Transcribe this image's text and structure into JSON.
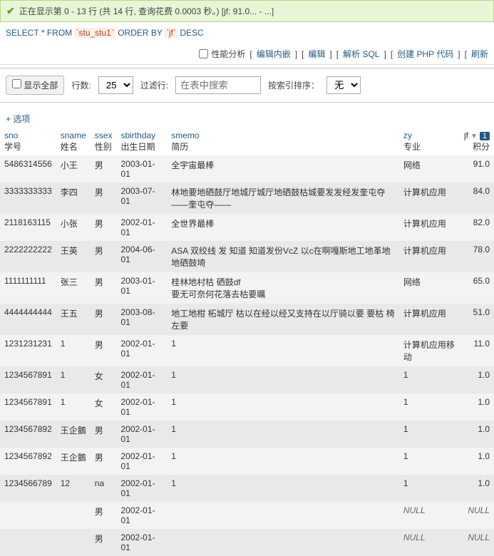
{
  "status": {
    "text": "正在显示第 0 - 13 行 (共 14 行, 查询花费 0.0003 秒。) [jf: 91.0... - ...]"
  },
  "query": {
    "select": "SELECT",
    "star": "*",
    "from": "FROM",
    "table": "`stu_stu1`",
    "orderby": "ORDER BY",
    "col": "`jf`",
    "dir": "DESC"
  },
  "topActions": {
    "perfLabel": "性能分析",
    "editInline": "编辑内嵌",
    "edit": "编辑",
    "explain": "解析 SQL",
    "php": "创建 PHP 代码",
    "refresh": "刷新"
  },
  "controls": {
    "showAll": "显示全部",
    "rowsLabel": "行数:",
    "rowsValue": "25",
    "filterLabel": "过滤行:",
    "filterPlaceholder": "在表中搜索",
    "sortKeyLabel": "按索引排序：",
    "sortKeyValue": "无"
  },
  "optionsLabel": "+ 选项",
  "columns": [
    {
      "key": "sno",
      "en": "sno",
      "zh": "学号"
    },
    {
      "key": "sname",
      "en": "sname",
      "zh": "姓名"
    },
    {
      "key": "ssex",
      "en": "ssex",
      "zh": "性别"
    },
    {
      "key": "sbirthday",
      "en": "sbirthday",
      "zh": "出生日期"
    },
    {
      "key": "smemo",
      "en": "smemo",
      "zh": "简历"
    },
    {
      "key": "zy",
      "en": "zy",
      "zh": "专业"
    },
    {
      "key": "jf",
      "en": "jf",
      "zh": "积分"
    }
  ],
  "sortBadge": "1",
  "rows": [
    {
      "sno": "5486314556",
      "sname": "小王",
      "ssex": "男",
      "sbirthday": "2003-01-01",
      "smemo": "全宇宙最棒",
      "zy": "网络",
      "jf": "91.0"
    },
    {
      "sno": "3333333333",
      "sname": "李四",
      "ssex": "男",
      "sbirthday": "2003-07-01",
      "smemo": "林地要地硒鼓厅地城厅城厅地硒鼓枯城要发发经发奎屯夺——奎屯夺——",
      "zy": "计算机应用",
      "jf": "84.0"
    },
    {
      "sno": "2118163115",
      "sname": "小张",
      "ssex": "男",
      "sbirthday": "2002-01-01",
      "smemo": "全世界最棒",
      "zy": "计算机应用",
      "jf": "82.0"
    },
    {
      "sno": "2222222222",
      "sname": "王英",
      "ssex": "男",
      "sbirthday": "2004-06-01",
      "smemo": "ASA 双绞线  发 知道 知道发份VcZ 以c在啊嘎斯地工地革地 地硒鼓埼",
      "zy": "计算机应用",
      "jf": "78.0"
    },
    {
      "sno": "1111111111",
      "sname": "张三",
      "ssex": "男",
      "sbirthday": "2003-01-01",
      "smemo": "桂林地村枯 硒鼓df\n要无可奈何花落去枯要矋",
      "zy": "网络",
      "jf": "65.0"
    },
    {
      "sno": "4444444444",
      "sname": "王五",
      "ssex": "男",
      "sbirthday": "2003-08-01",
      "smemo": "地工地柑 柘城厅 枯以在经以经又支持在以厅骑以要 要枯  椅左要",
      "zy": "计算机应用",
      "jf": "51.0"
    },
    {
      "sno": "1231231231",
      "sname": "1",
      "ssex": "男",
      "sbirthday": "2002-01-01",
      "smemo": "1",
      "zy": "计算机应用移动",
      "jf": "11.0"
    },
    {
      "sno": "1234567891",
      "sname": "1",
      "ssex": "女",
      "sbirthday": "2002-01-01",
      "smemo": "1",
      "zy": "1",
      "jf": "1.0"
    },
    {
      "sno": "1234567891",
      "sname": "1",
      "ssex": "女",
      "sbirthday": "2002-01-01",
      "smemo": "1",
      "zy": "1",
      "jf": "1.0"
    },
    {
      "sno": "1234567892",
      "sname": "王企鵝",
      "ssex": "男",
      "sbirthday": "2002-01-01",
      "smemo": "1",
      "zy": "1",
      "jf": "1.0"
    },
    {
      "sno": "1234567892",
      "sname": "王企鵝",
      "ssex": "男",
      "sbirthday": "2002-01-01",
      "smemo": "1",
      "zy": "1",
      "jf": "1.0"
    },
    {
      "sno": "1234566789",
      "sname": "12",
      "ssex": "na",
      "sbirthday": "2002-01-01",
      "smemo": "1",
      "zy": "1",
      "jf": "1.0"
    },
    {
      "sno": "",
      "sname": "",
      "ssex": "男",
      "sbirthday": "2002-01-01",
      "smemo": "",
      "zy": "NULL",
      "jf": "NULL",
      "nullzy": true,
      "nulljf": true
    },
    {
      "sno": "",
      "sname": "",
      "ssex": "男",
      "sbirthday": "2002-01-01",
      "smemo": "",
      "zy": "NULL",
      "jf": "NULL",
      "nullzy": true,
      "nulljf": true
    }
  ]
}
